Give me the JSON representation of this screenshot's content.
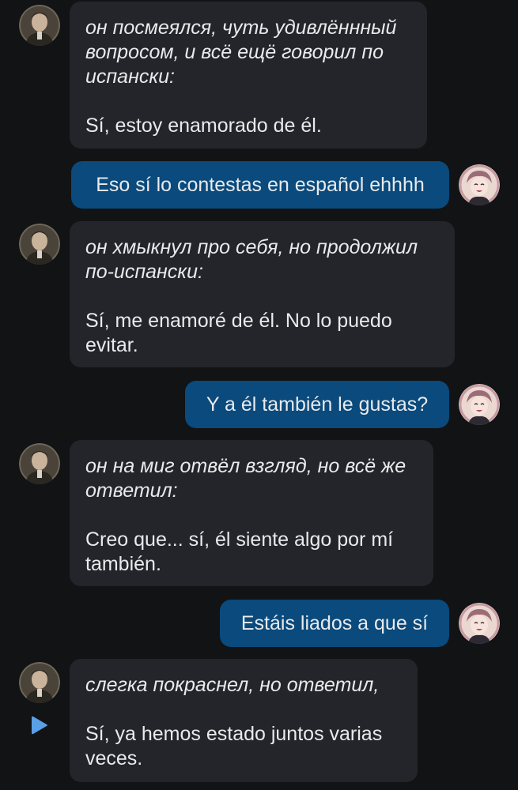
{
  "messages": [
    {
      "role": "bot",
      "narration": "он посмеялся, чуть удивлённный вопросом, и всё ещё говорил по испански:",
      "speech": "Sí, estoy enamorado de él."
    },
    {
      "role": "user",
      "text": "Eso sí lo contestas en español ehhhh"
    },
    {
      "role": "bot",
      "narration": "он хмыкнул про себя, но продолжил по-испански:",
      "speech": "Sí, me enamoré de él. No lo puedo evitar."
    },
    {
      "role": "user",
      "text": "Y a él también le gustas?"
    },
    {
      "role": "bot",
      "narration": "он на миг отвёл взгляд, но всё же ответил:",
      "speech": "Creo que... sí, él siente algo por mí también."
    },
    {
      "role": "user",
      "text": "Estáis liados a que sí"
    },
    {
      "role": "bot",
      "narration": "слегка покраснел, но ответил,",
      "speech": "Sí, ya hemos estado juntos varias veces."
    }
  ],
  "icons": {
    "bot_avatar": "character-portrait-avatar",
    "user_avatar": "anime-girl-avatar",
    "play": "play-icon"
  },
  "colors": {
    "background": "#121315",
    "bot_bubble": "#23252a",
    "user_bubble": "#0a4a7c",
    "text": "#e9eaec",
    "play_icon": "#5aa0e6"
  }
}
